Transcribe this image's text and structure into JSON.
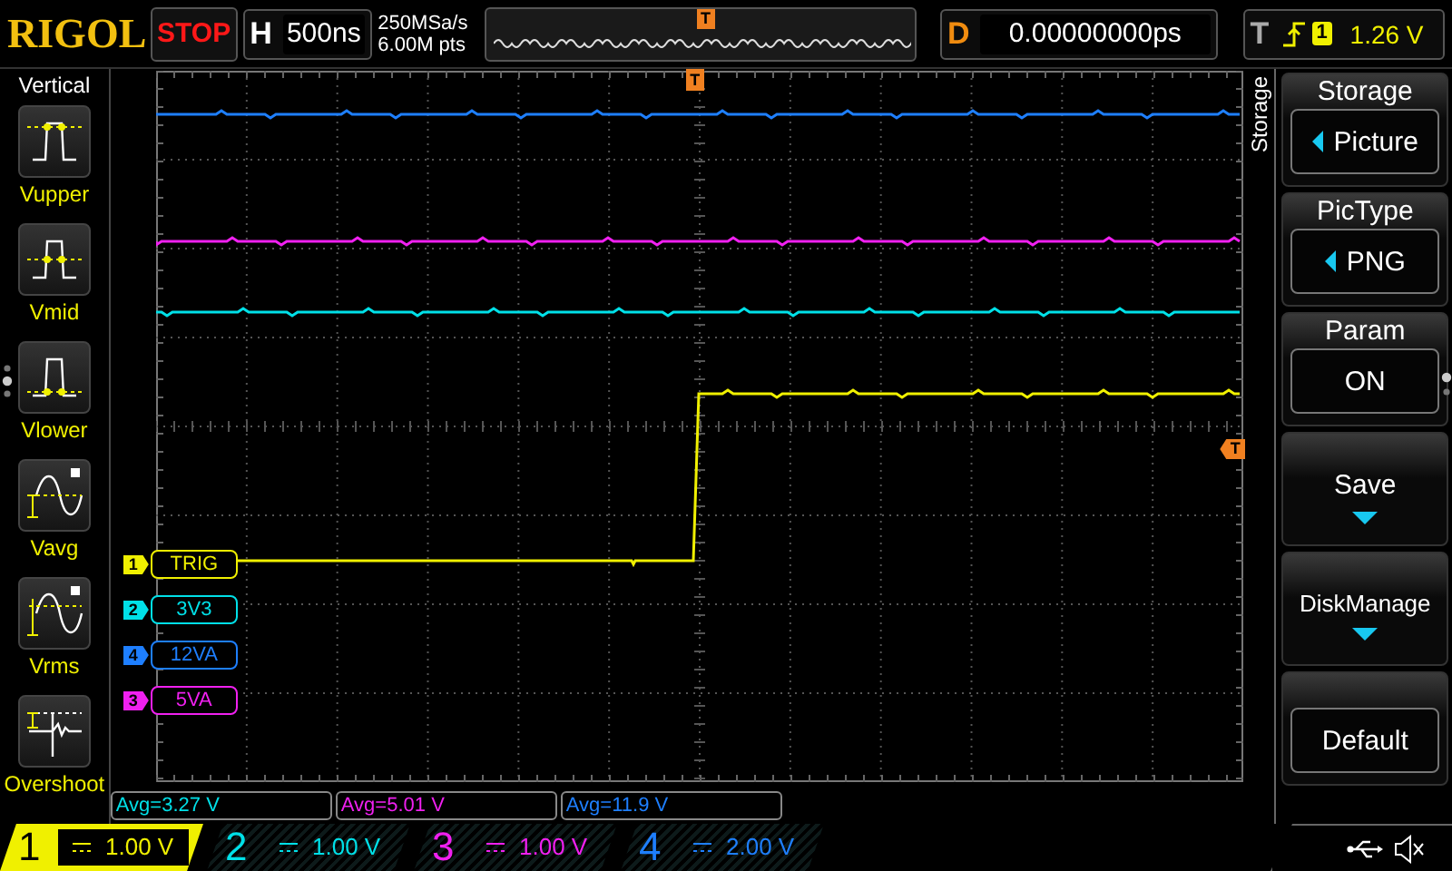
{
  "logo": "RIGOL",
  "run_state": "STOP",
  "timebase": {
    "label": "H",
    "value": "500ns"
  },
  "acquisition": [
    "250MSa/s",
    "6.00M pts"
  ],
  "overview_marker": "T",
  "delay": {
    "label": "D",
    "value": "0.00000000ps"
  },
  "trigger": {
    "label": "T",
    "source": "1",
    "level": "1.26 V"
  },
  "trigger_position_marker": "T",
  "trigger_level_marker": "T",
  "measure_menu": {
    "title": "Vertical",
    "items": [
      {
        "label": "Vupper",
        "kind": "upper"
      },
      {
        "label": "Vmid",
        "kind": "mid"
      },
      {
        "label": "Vlower",
        "kind": "lower"
      },
      {
        "label": "Vavg",
        "kind": "avg"
      },
      {
        "label": "Vrms",
        "kind": "rms"
      },
      {
        "label": "Overshoot",
        "kind": "overshoot"
      }
    ]
  },
  "waveform_labels": [
    {
      "channel": "1",
      "label": "TRIG",
      "color": "#f0f000"
    },
    {
      "channel": "2",
      "label": "3V3",
      "color": "#00e0e8"
    },
    {
      "channel": "4",
      "label": "12VA",
      "color": "#1e7fff"
    },
    {
      "channel": "3",
      "label": "5VA",
      "color": "#f020f0"
    }
  ],
  "measurements": [
    {
      "text": "Avg=3.27 V",
      "color": "#00e0e8"
    },
    {
      "text": "Avg=5.01 V",
      "color": "#f020f0"
    },
    {
      "text": "Avg=11.9 V",
      "color": "#1e7fff"
    }
  ],
  "channels": [
    {
      "number": "1",
      "scale": "1.00 V",
      "color": "#f0f000",
      "selected": true
    },
    {
      "number": "2",
      "scale": "1.00 V",
      "color": "#00e0e8",
      "selected": false
    },
    {
      "number": "3",
      "scale": "1.00 V",
      "color": "#f020f0",
      "selected": false
    },
    {
      "number": "4",
      "scale": "2.00 V",
      "color": "#1e7fff",
      "selected": false
    }
  ],
  "softkey_menu": {
    "title": "Storage",
    "items": [
      {
        "label": "Storage",
        "value": "Picture",
        "kind": "option"
      },
      {
        "label": "PicType",
        "value": "PNG",
        "kind": "option"
      },
      {
        "label": "Param",
        "value": "ON",
        "kind": "value"
      },
      {
        "label": "Save",
        "kind": "submenu"
      },
      {
        "label": "DiskManage",
        "kind": "submenu"
      },
      {
        "label": "Default",
        "kind": "action"
      }
    ]
  }
}
